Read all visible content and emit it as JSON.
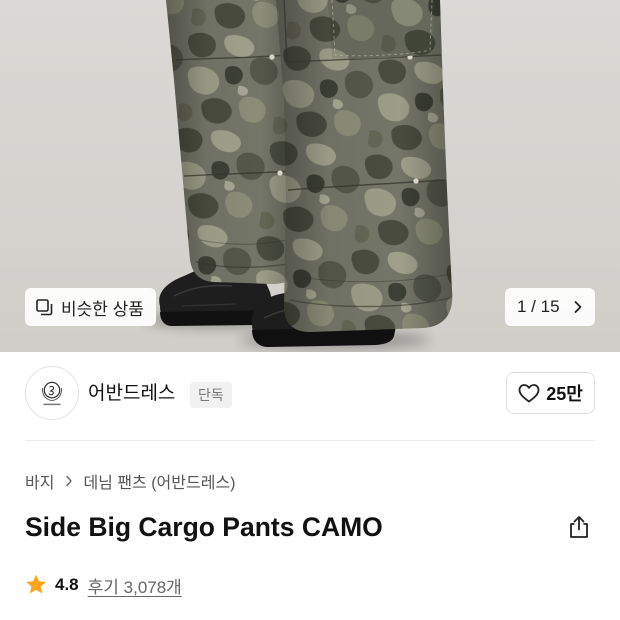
{
  "gallery": {
    "similar_button": {
      "icon": "similar-items-icon",
      "label": "비슷한 상품"
    },
    "pager": {
      "label": "1 / 15",
      "icon": "chevron-right-icon"
    }
  },
  "brand": {
    "logo": "brand-logo",
    "name": "어반드레스",
    "badge": "단독"
  },
  "like_button": {
    "icon": "heart-icon",
    "count": "25만"
  },
  "breadcrumb": {
    "items": [
      "바지",
      "데님 팬츠 (어반드레스)"
    ],
    "separator_icon": "chevron-right-icon"
  },
  "product": {
    "title": "Side Big Cargo Pants CAMO",
    "share_icon": "share-icon"
  },
  "rating": {
    "icon": "star-icon",
    "score": "4.8",
    "reviews_label": "후기 3,078개"
  },
  "colors": {
    "star": "#ffa31a",
    "badge_background": "#f1f1f1",
    "text_primary": "#111111",
    "text_secondary": "#666666",
    "photo_background": "#d8d6d2"
  }
}
